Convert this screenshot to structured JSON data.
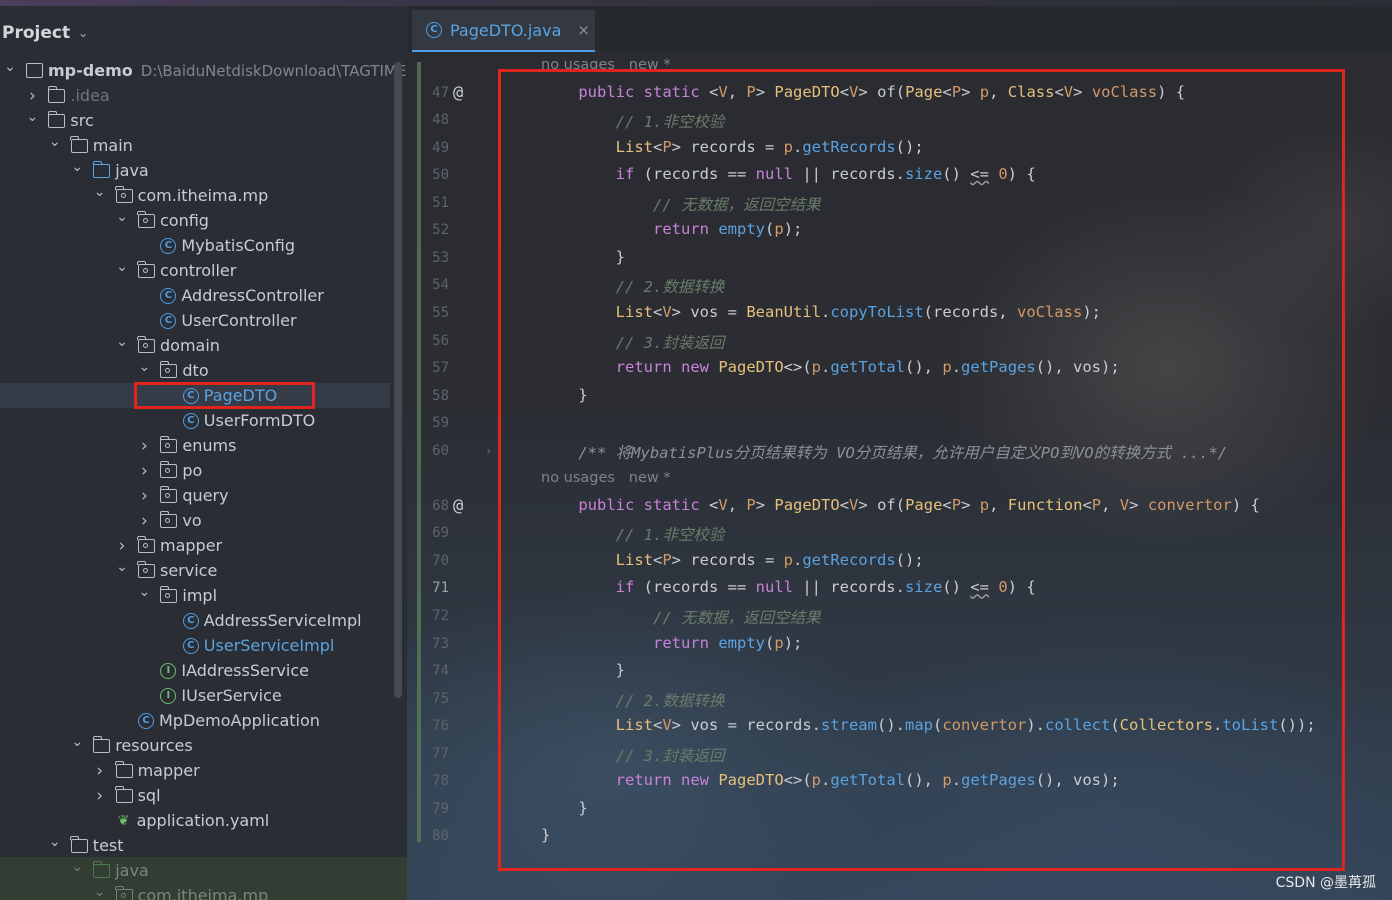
{
  "project_panel": {
    "title": "Project",
    "tree": [
      {
        "label": "mp-demo",
        "path": "D:\\BaiduNetdiskDownload\\TAGTIME",
        "icon": "module-folder-icon",
        "indent": 0,
        "arrow": "down",
        "bold": true
      },
      {
        "label": ".idea",
        "icon": "folder-icon",
        "indent": 1,
        "arrow": "right",
        "dim": true
      },
      {
        "label": "src",
        "icon": "folder-icon",
        "indent": 1,
        "arrow": "down"
      },
      {
        "label": "main",
        "icon": "folder-icon",
        "indent": 2,
        "arrow": "down"
      },
      {
        "label": "java",
        "icon": "source-folder-icon",
        "indent": 3,
        "arrow": "down"
      },
      {
        "label": "com.itheima.mp",
        "icon": "package-icon",
        "indent": 4,
        "arrow": "down"
      },
      {
        "label": "config",
        "icon": "package-icon",
        "indent": 5,
        "arrow": "down"
      },
      {
        "label": "MybatisConfig",
        "icon": "class-icon",
        "indent": 6,
        "arrow": "none"
      },
      {
        "label": "controller",
        "icon": "package-icon",
        "indent": 5,
        "arrow": "down"
      },
      {
        "label": "AddressController",
        "icon": "class-icon",
        "indent": 6,
        "arrow": "none"
      },
      {
        "label": "UserController",
        "icon": "class-icon",
        "indent": 6,
        "arrow": "none"
      },
      {
        "label": "domain",
        "icon": "package-icon",
        "indent": 5,
        "arrow": "down"
      },
      {
        "label": "dto",
        "icon": "package-icon",
        "indent": 6,
        "arrow": "down"
      },
      {
        "label": "PageDTO",
        "icon": "class-icon",
        "indent": 7,
        "arrow": "none",
        "selected": true,
        "blue": true
      },
      {
        "label": "UserFormDTO",
        "icon": "class-icon",
        "indent": 7,
        "arrow": "none"
      },
      {
        "label": "enums",
        "icon": "package-icon",
        "indent": 6,
        "arrow": "right"
      },
      {
        "label": "po",
        "icon": "package-icon",
        "indent": 6,
        "arrow": "right"
      },
      {
        "label": "query",
        "icon": "package-icon",
        "indent": 6,
        "arrow": "right"
      },
      {
        "label": "vo",
        "icon": "package-icon",
        "indent": 6,
        "arrow": "right"
      },
      {
        "label": "mapper",
        "icon": "package-icon",
        "indent": 5,
        "arrow": "right"
      },
      {
        "label": "service",
        "icon": "package-icon",
        "indent": 5,
        "arrow": "down"
      },
      {
        "label": "impl",
        "icon": "package-icon",
        "indent": 6,
        "arrow": "down"
      },
      {
        "label": "AddressServiceImpl",
        "icon": "class-icon",
        "indent": 7,
        "arrow": "none"
      },
      {
        "label": "UserServiceImpl",
        "icon": "class-icon",
        "indent": 7,
        "arrow": "none",
        "blue": true
      },
      {
        "label": "IAddressService",
        "icon": "interface-icon",
        "indent": 6,
        "arrow": "none"
      },
      {
        "label": "IUserService",
        "icon": "interface-icon",
        "indent": 6,
        "arrow": "none"
      },
      {
        "label": "MpDemoApplication",
        "icon": "spring-app-icon",
        "indent": 5,
        "arrow": "none"
      },
      {
        "label": "resources",
        "icon": "resources-folder-icon",
        "indent": 3,
        "arrow": "down"
      },
      {
        "label": "mapper",
        "icon": "folder-icon",
        "indent": 4,
        "arrow": "right"
      },
      {
        "label": "sql",
        "icon": "folder-icon",
        "indent": 4,
        "arrow": "right"
      },
      {
        "label": "application.yaml",
        "icon": "yaml-leaf-icon",
        "indent": 4,
        "arrow": "none"
      },
      {
        "label": "test",
        "icon": "folder-icon",
        "indent": 2,
        "arrow": "down"
      },
      {
        "label": "java",
        "icon": "test-folder-icon",
        "indent": 3,
        "arrow": "down"
      },
      {
        "label": "com.itheima.mp",
        "icon": "package-icon",
        "indent": 4,
        "arrow": "down"
      }
    ]
  },
  "editor": {
    "tab_label": "PageDTO.java",
    "tab_close": "×",
    "lines": [
      {
        "kind": "hint",
        "text": "no usages   new *"
      },
      {
        "num": "47",
        "at": true,
        "tokens": [
          [
            "    ",
            "pl"
          ],
          [
            "public",
            "kw"
          ],
          [
            " ",
            "pl"
          ],
          [
            "static",
            "kw"
          ],
          [
            " <",
            "pl"
          ],
          [
            "V",
            "tp"
          ],
          [
            ", ",
            "pl"
          ],
          [
            "P",
            "tp"
          ],
          [
            "> ",
            "pl"
          ],
          [
            "PageDTO",
            "ty"
          ],
          [
            "<",
            "pl"
          ],
          [
            "V",
            "tp"
          ],
          [
            "> ",
            "pl"
          ],
          [
            "of",
            "pl"
          ],
          [
            "(",
            "pl"
          ],
          [
            "Page",
            "ty"
          ],
          [
            "<",
            "pl"
          ],
          [
            "P",
            "tp"
          ],
          [
            "> ",
            "pl"
          ],
          [
            "p",
            "nm"
          ],
          [
            ", ",
            "pl"
          ],
          [
            "Class",
            "ty"
          ],
          [
            "<",
            "pl"
          ],
          [
            "V",
            "tp"
          ],
          [
            "> ",
            "pl"
          ],
          [
            "voClass",
            "nm"
          ],
          [
            ") {",
            "pl"
          ]
        ]
      },
      {
        "num": "48",
        "tokens": [
          [
            "        ",
            "pl"
          ],
          [
            "// 1.非空校验",
            "cm"
          ]
        ]
      },
      {
        "num": "49",
        "tokens": [
          [
            "        ",
            "pl"
          ],
          [
            "List",
            "ty"
          ],
          [
            "<",
            "pl"
          ],
          [
            "P",
            "tp"
          ],
          [
            "> records = ",
            "pl"
          ],
          [
            "p",
            "nm"
          ],
          [
            ".",
            "pl"
          ],
          [
            "getRecords",
            "fn"
          ],
          [
            "();",
            "pl"
          ]
        ]
      },
      {
        "num": "50",
        "tokens": [
          [
            "        ",
            "pl"
          ],
          [
            "if",
            "kw"
          ],
          [
            " (records == ",
            "pl"
          ],
          [
            "null",
            "kw"
          ],
          [
            " || records.",
            "pl"
          ],
          [
            "size",
            "fn"
          ],
          [
            "() ",
            "pl"
          ],
          [
            "<=",
            "hl"
          ],
          [
            " ",
            "pl"
          ],
          [
            "0",
            "nm"
          ],
          [
            ") {",
            "pl"
          ]
        ]
      },
      {
        "num": "51",
        "tokens": [
          [
            "            ",
            "pl"
          ],
          [
            "// 无数据，返回空结果",
            "cm"
          ]
        ]
      },
      {
        "num": "52",
        "tokens": [
          [
            "            ",
            "pl"
          ],
          [
            "return",
            "kw"
          ],
          [
            " ",
            "pl"
          ],
          [
            "empty",
            "fn"
          ],
          [
            "(",
            "pl"
          ],
          [
            "p",
            "nm"
          ],
          [
            ");",
            "pl"
          ]
        ]
      },
      {
        "num": "53",
        "tokens": [
          [
            "        }",
            "pl"
          ]
        ]
      },
      {
        "num": "54",
        "tokens": [
          [
            "        ",
            "pl"
          ],
          [
            "// 2.数据转换",
            "cm"
          ]
        ]
      },
      {
        "num": "55",
        "tokens": [
          [
            "        ",
            "pl"
          ],
          [
            "List",
            "ty"
          ],
          [
            "<",
            "pl"
          ],
          [
            "V",
            "tp"
          ],
          [
            "> vos = ",
            "pl"
          ],
          [
            "BeanUtil",
            "ty"
          ],
          [
            ".",
            "pl"
          ],
          [
            "copyToList",
            "fn"
          ],
          [
            "(records, ",
            "pl"
          ],
          [
            "voClass",
            "nm"
          ],
          [
            ");",
            "pl"
          ]
        ]
      },
      {
        "num": "56",
        "tokens": [
          [
            "        ",
            "pl"
          ],
          [
            "// 3.封装返回",
            "cm"
          ]
        ]
      },
      {
        "num": "57",
        "tokens": [
          [
            "        ",
            "pl"
          ],
          [
            "return",
            "kw"
          ],
          [
            " ",
            "pl"
          ],
          [
            "new",
            "kw"
          ],
          [
            " ",
            "pl"
          ],
          [
            "PageDTO",
            "ty"
          ],
          [
            "<>(",
            "pl"
          ],
          [
            "p",
            "nm"
          ],
          [
            ".",
            "pl"
          ],
          [
            "getTotal",
            "fn"
          ],
          [
            "(), ",
            "pl"
          ],
          [
            "p",
            "nm"
          ],
          [
            ".",
            "pl"
          ],
          [
            "getPages",
            "fn"
          ],
          [
            "(), vos);",
            "pl"
          ]
        ]
      },
      {
        "num": "58",
        "tokens": [
          [
            "    }",
            "pl"
          ]
        ]
      },
      {
        "num": "59",
        "tokens": []
      },
      {
        "num": "60",
        "fold": true,
        "tokens": [
          [
            "    ",
            "pl"
          ],
          [
            "/** 将MybatisPlus分页结果转为 VO分页结果，允许用户自定义PO到VO的转换方式 ...*/",
            "dc"
          ]
        ]
      },
      {
        "kind": "hint",
        "text": "no usages   new *"
      },
      {
        "num": "68",
        "at": true,
        "tokens": [
          [
            "    ",
            "pl"
          ],
          [
            "public",
            "kw"
          ],
          [
            " ",
            "pl"
          ],
          [
            "static",
            "kw"
          ],
          [
            " <",
            "pl"
          ],
          [
            "V",
            "tp"
          ],
          [
            ", ",
            "pl"
          ],
          [
            "P",
            "tp"
          ],
          [
            "> ",
            "pl"
          ],
          [
            "PageDTO",
            "ty"
          ],
          [
            "<",
            "pl"
          ],
          [
            "V",
            "tp"
          ],
          [
            "> ",
            "pl"
          ],
          [
            "of",
            "pl"
          ],
          [
            "(",
            "pl"
          ],
          [
            "Page",
            "ty"
          ],
          [
            "<",
            "pl"
          ],
          [
            "P",
            "tp"
          ],
          [
            "> ",
            "pl"
          ],
          [
            "p",
            "nm"
          ],
          [
            ", ",
            "pl"
          ],
          [
            "Function",
            "ty"
          ],
          [
            "<",
            "pl"
          ],
          [
            "P",
            "tp"
          ],
          [
            ", ",
            "pl"
          ],
          [
            "V",
            "tp"
          ],
          [
            "> ",
            "pl"
          ],
          [
            "convertor",
            "nm"
          ],
          [
            ") {",
            "pl"
          ]
        ]
      },
      {
        "num": "69",
        "tokens": [
          [
            "        ",
            "pl"
          ],
          [
            "// 1.非空校验",
            "cm"
          ]
        ]
      },
      {
        "num": "70",
        "tokens": [
          [
            "        ",
            "pl"
          ],
          [
            "List",
            "ty"
          ],
          [
            "<",
            "pl"
          ],
          [
            "P",
            "tp"
          ],
          [
            "> records = ",
            "pl"
          ],
          [
            "p",
            "nm"
          ],
          [
            ".",
            "pl"
          ],
          [
            "getRecords",
            "fn"
          ],
          [
            "();",
            "pl"
          ]
        ]
      },
      {
        "num": "71",
        "cur": true,
        "tokens": [
          [
            "        ",
            "pl"
          ],
          [
            "if",
            "kw"
          ],
          [
            " (records == ",
            "pl"
          ],
          [
            "null",
            "kw"
          ],
          [
            " || records.",
            "pl"
          ],
          [
            "size",
            "fn"
          ],
          [
            "() ",
            "pl"
          ],
          [
            "<=",
            "hl"
          ],
          [
            " ",
            "pl"
          ],
          [
            "0",
            "nm"
          ],
          [
            ") {",
            "pl"
          ]
        ]
      },
      {
        "num": "72",
        "tokens": [
          [
            "            ",
            "pl"
          ],
          [
            "// 无数据，返回空结果",
            "cm"
          ]
        ]
      },
      {
        "num": "73",
        "tokens": [
          [
            "            ",
            "pl"
          ],
          [
            "return",
            "kw"
          ],
          [
            " ",
            "pl"
          ],
          [
            "empty",
            "fn"
          ],
          [
            "(",
            "pl"
          ],
          [
            "p",
            "nm"
          ],
          [
            ");",
            "pl"
          ]
        ]
      },
      {
        "num": "74",
        "tokens": [
          [
            "        }",
            "pl"
          ]
        ]
      },
      {
        "num": "75",
        "tokens": [
          [
            "        ",
            "pl"
          ],
          [
            "// 2.数据转换",
            "cm"
          ]
        ]
      },
      {
        "num": "76",
        "tokens": [
          [
            "        ",
            "pl"
          ],
          [
            "List",
            "ty"
          ],
          [
            "<",
            "pl"
          ],
          [
            "V",
            "tp"
          ],
          [
            "> vos = records.",
            "pl"
          ],
          [
            "stream",
            "fn"
          ],
          [
            "().",
            "pl"
          ],
          [
            "map",
            "fn"
          ],
          [
            "(",
            "pl"
          ],
          [
            "convertor",
            "nm"
          ],
          [
            ").",
            "pl"
          ],
          [
            "collect",
            "fn"
          ],
          [
            "(",
            "pl"
          ],
          [
            "Collectors",
            "ty"
          ],
          [
            ".",
            "pl"
          ],
          [
            "toList",
            "fn"
          ],
          [
            "());",
            "pl"
          ]
        ]
      },
      {
        "num": "77",
        "tokens": [
          [
            "        ",
            "pl"
          ],
          [
            "// 3.封装返回",
            "cm"
          ]
        ]
      },
      {
        "num": "78",
        "tokens": [
          [
            "        ",
            "pl"
          ],
          [
            "return",
            "kw"
          ],
          [
            " ",
            "pl"
          ],
          [
            "new",
            "kw"
          ],
          [
            " ",
            "pl"
          ],
          [
            "PageDTO",
            "ty"
          ],
          [
            "<>(",
            "pl"
          ],
          [
            "p",
            "nm"
          ],
          [
            ".",
            "pl"
          ],
          [
            "getTotal",
            "fn"
          ],
          [
            "(), ",
            "pl"
          ],
          [
            "p",
            "nm"
          ],
          [
            ".",
            "pl"
          ],
          [
            "getPages",
            "fn"
          ],
          [
            "(), vos);",
            "pl"
          ]
        ]
      },
      {
        "num": "79",
        "tokens": [
          [
            "    }",
            "pl"
          ]
        ]
      },
      {
        "num": "80",
        "tokens": [
          [
            "}",
            "pl"
          ]
        ]
      }
    ]
  },
  "watermark": "CSDN @墨苒孤",
  "colors": {
    "highlight_box": "#e2241f",
    "accent": "#4f9de3"
  }
}
